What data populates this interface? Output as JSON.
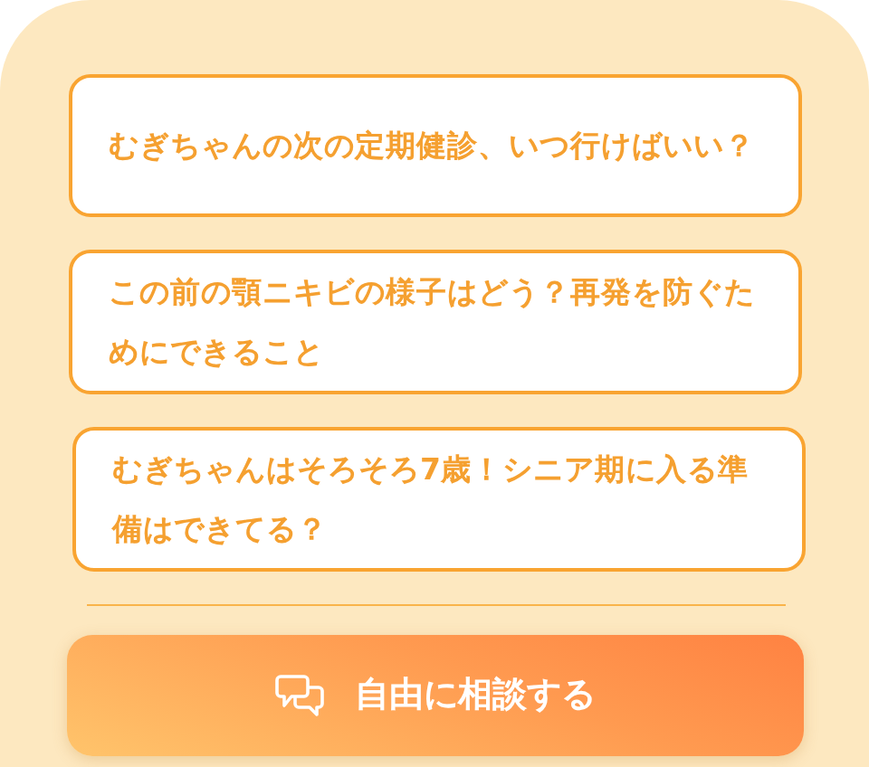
{
  "suggestions": [
    {
      "text": "むぎちゃんの次の定期健診、いつ行けばいい？"
    },
    {
      "text": "この前の顎ニキビの様子はどう？再発を防ぐためにできること"
    },
    {
      "text": "むぎちゃんはそろそろ7歳！シニア期に入る準備はできてる？"
    }
  ],
  "action_button": {
    "label": "自由に相談する"
  }
}
